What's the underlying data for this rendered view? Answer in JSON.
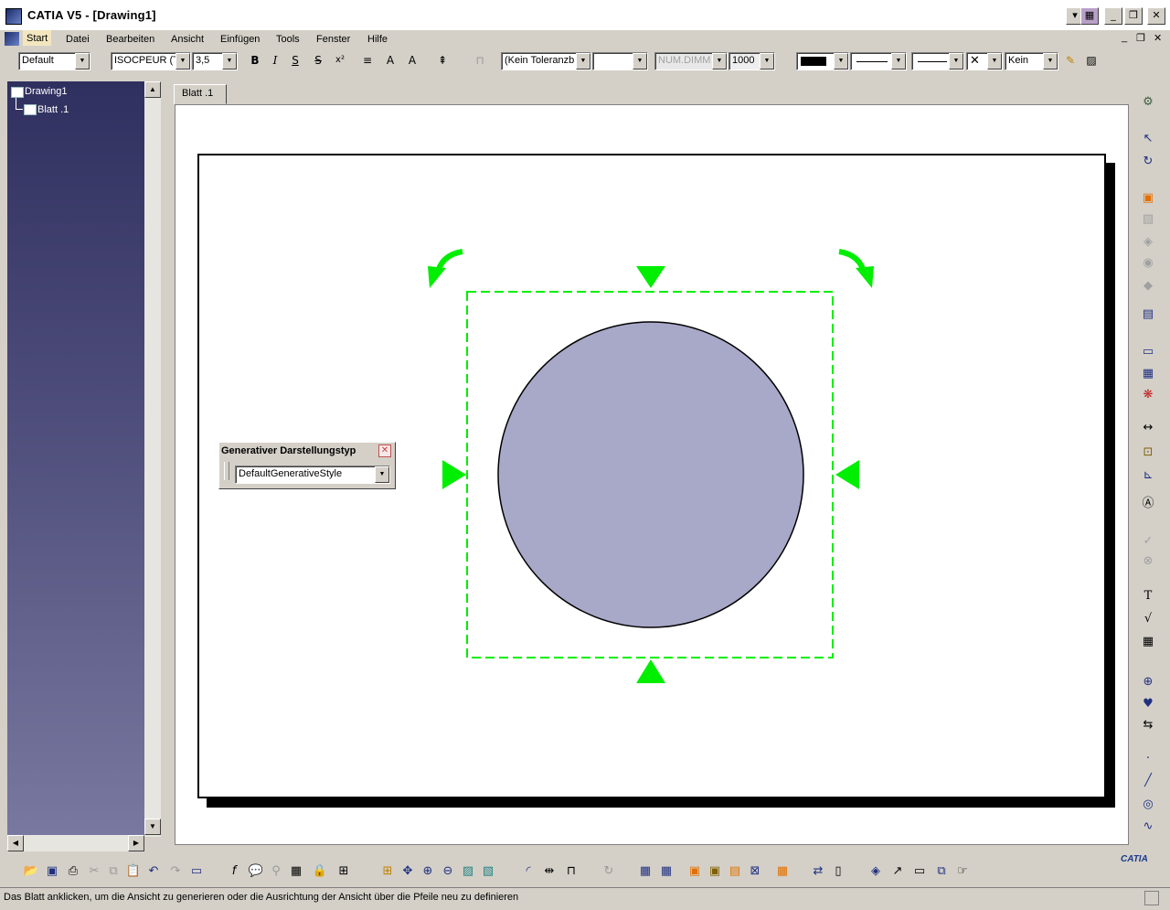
{
  "window": {
    "title": "CATIA V5 - [Drawing1]"
  },
  "menu": [
    "Start",
    "Datei",
    "Bearbeiten",
    "Ansicht",
    "Einfügen",
    "Tools",
    "Fenster",
    "Hilfe"
  ],
  "toolbar": {
    "style": "Default",
    "font": "ISOCPEUR (Ti",
    "font_size": "3,5",
    "tolerance": "(Kein Toleranzb",
    "tolerance2": "",
    "num_format": "NUM.DIMM",
    "precision": "1000",
    "pattern": "Kein"
  },
  "tree": {
    "root": "Drawing1",
    "child": "Blatt .1"
  },
  "tabs": {
    "sheet": "Blatt .1"
  },
  "floating_toolbar": {
    "title": "Generativer Darstellungstyp",
    "value": "DefaultGenerativeStyle"
  },
  "status": "Das Blatt anklicken, um die Ansicht zu generieren oder die Ausrichtung der Ansicht über die Pfeile neu zu definieren",
  "brand": "CATIA",
  "colors": {
    "accent_green": "#00ee00",
    "circle_fill": "#a8a8c8",
    "tree_bg": "#3c3c6c"
  }
}
